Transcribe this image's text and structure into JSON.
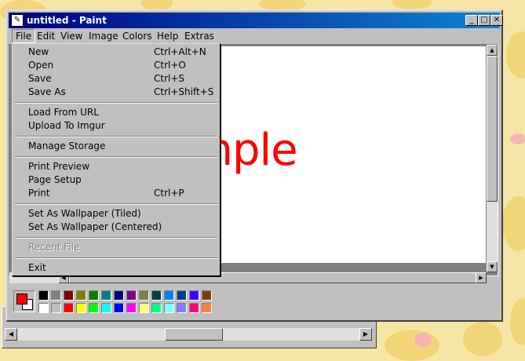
{
  "window": {
    "title": "untitled - Paint",
    "controls": {
      "minimize": "_",
      "maximize": "□",
      "close": "✕"
    }
  },
  "menubar": [
    {
      "label": "File",
      "open": true
    },
    {
      "label": "Edit"
    },
    {
      "label": "View"
    },
    {
      "label": "Image"
    },
    {
      "label": "Colors"
    },
    {
      "label": "Help"
    },
    {
      "label": "Extras"
    }
  ],
  "file_menu": {
    "groups": [
      [
        {
          "label": "New",
          "shortcut": "Ctrl+Alt+N"
        },
        {
          "label": "Open",
          "shortcut": "Ctrl+O"
        },
        {
          "label": "Save",
          "shortcut": "Ctrl+S"
        },
        {
          "label": "Save As",
          "shortcut": "Ctrl+Shift+S"
        }
      ],
      [
        {
          "label": "Load From URL",
          "shortcut": ""
        },
        {
          "label": "Upload To Imgur",
          "shortcut": ""
        }
      ],
      [
        {
          "label": "Manage Storage",
          "shortcut": ""
        }
      ],
      [
        {
          "label": "Print Preview",
          "shortcut": ""
        },
        {
          "label": "Page Setup",
          "shortcut": ""
        },
        {
          "label": "Print",
          "shortcut": "Ctrl+P"
        }
      ],
      [
        {
          "label": "Set As Wallpaper (Tiled)",
          "shortcut": ""
        },
        {
          "label": "Set As Wallpaper (Centered)",
          "shortcut": ""
        }
      ],
      [
        {
          "label": "Recent File",
          "shortcut": "",
          "disabled": true
        }
      ],
      [
        {
          "label": "Exit",
          "shortcut": ""
        }
      ]
    ]
  },
  "canvas": {
    "text": "xample",
    "text_color": "#ff0000"
  },
  "colors": {
    "foreground": "#ff0000",
    "background": "#ffffff",
    "palette_row1": [
      "#000000",
      "#808080",
      "#800000",
      "#808000",
      "#008000",
      "#008080",
      "#000080",
      "#800080",
      "#808040",
      "#004040",
      "#0080ff",
      "#004080",
      "#4000ff",
      "#804000"
    ],
    "palette_row2": [
      "#ffffff",
      "#c0c0c0",
      "#ff0000",
      "#ffff00",
      "#00ff00",
      "#00ffff",
      "#0000ff",
      "#ff00ff",
      "#ffff80",
      "#00ff80",
      "#80ffff",
      "#8080ff",
      "#ff0080",
      "#ff8040"
    ]
  }
}
